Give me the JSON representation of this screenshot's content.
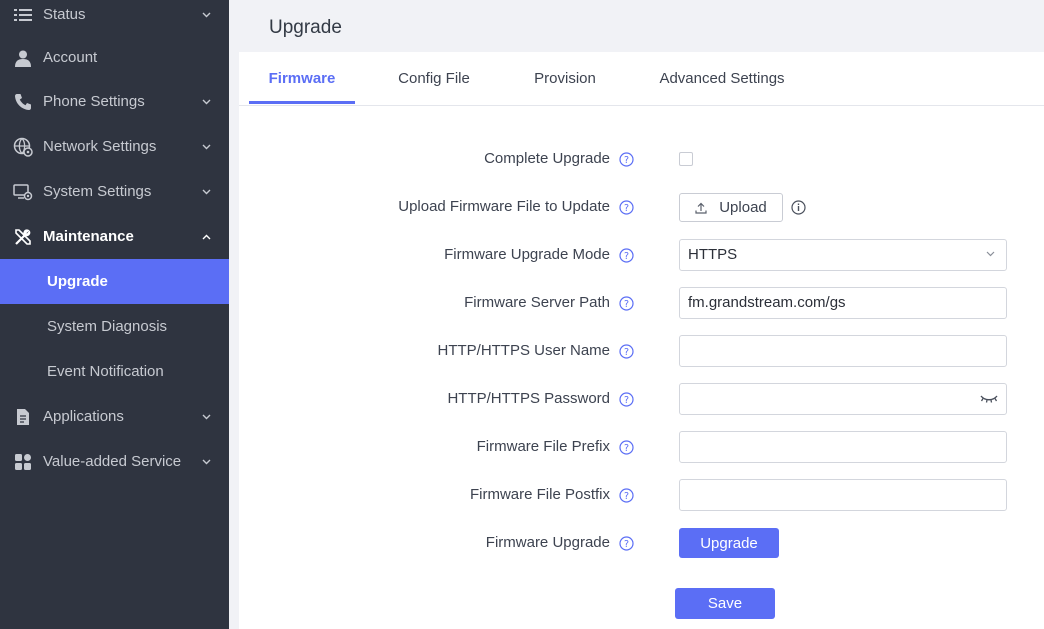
{
  "sidebar": {
    "items": [
      {
        "label": "Status",
        "icon": "list-icon"
      },
      {
        "label": "Account",
        "icon": "user-icon"
      },
      {
        "label": "Phone Settings",
        "icon": "phone-icon"
      },
      {
        "label": "Network Settings",
        "icon": "network-icon"
      },
      {
        "label": "System Settings",
        "icon": "monitor-gear-icon"
      },
      {
        "label": "Maintenance",
        "icon": "tools-icon"
      },
      {
        "label": "Applications",
        "icon": "document-icon"
      },
      {
        "label": "Value-added Service",
        "icon": "grid-icon"
      }
    ],
    "maintenance_sub": [
      {
        "label": "Upgrade"
      },
      {
        "label": "System Diagnosis"
      },
      {
        "label": "Event Notification"
      }
    ]
  },
  "main": {
    "title": "Upgrade",
    "tabs": [
      {
        "label": "Firmware"
      },
      {
        "label": "Config File"
      },
      {
        "label": "Provision"
      },
      {
        "label": "Advanced Settings"
      }
    ],
    "form": {
      "complete_upgrade": {
        "label": "Complete Upgrade",
        "checked": false
      },
      "upload": {
        "label": "Upload Firmware File to Update",
        "button": "Upload"
      },
      "mode": {
        "label": "Firmware Upgrade Mode",
        "value": "HTTPS"
      },
      "server_path": {
        "label": "Firmware Server Path",
        "value": "fm.grandstream.com/gs"
      },
      "username": {
        "label": "HTTP/HTTPS User Name",
        "value": ""
      },
      "password": {
        "label": "HTTP/HTTPS Password",
        "value": ""
      },
      "prefix": {
        "label": "Firmware File Prefix",
        "value": ""
      },
      "postfix": {
        "label": "Firmware File Postfix",
        "value": ""
      },
      "upgrade": {
        "label": "Firmware Upgrade",
        "button": "Upgrade"
      }
    },
    "save_label": "Save"
  },
  "colors": {
    "accent": "#5b6ef5",
    "sidebar_bg": "#2f3440",
    "sidebar_text": "#c7cad1"
  }
}
